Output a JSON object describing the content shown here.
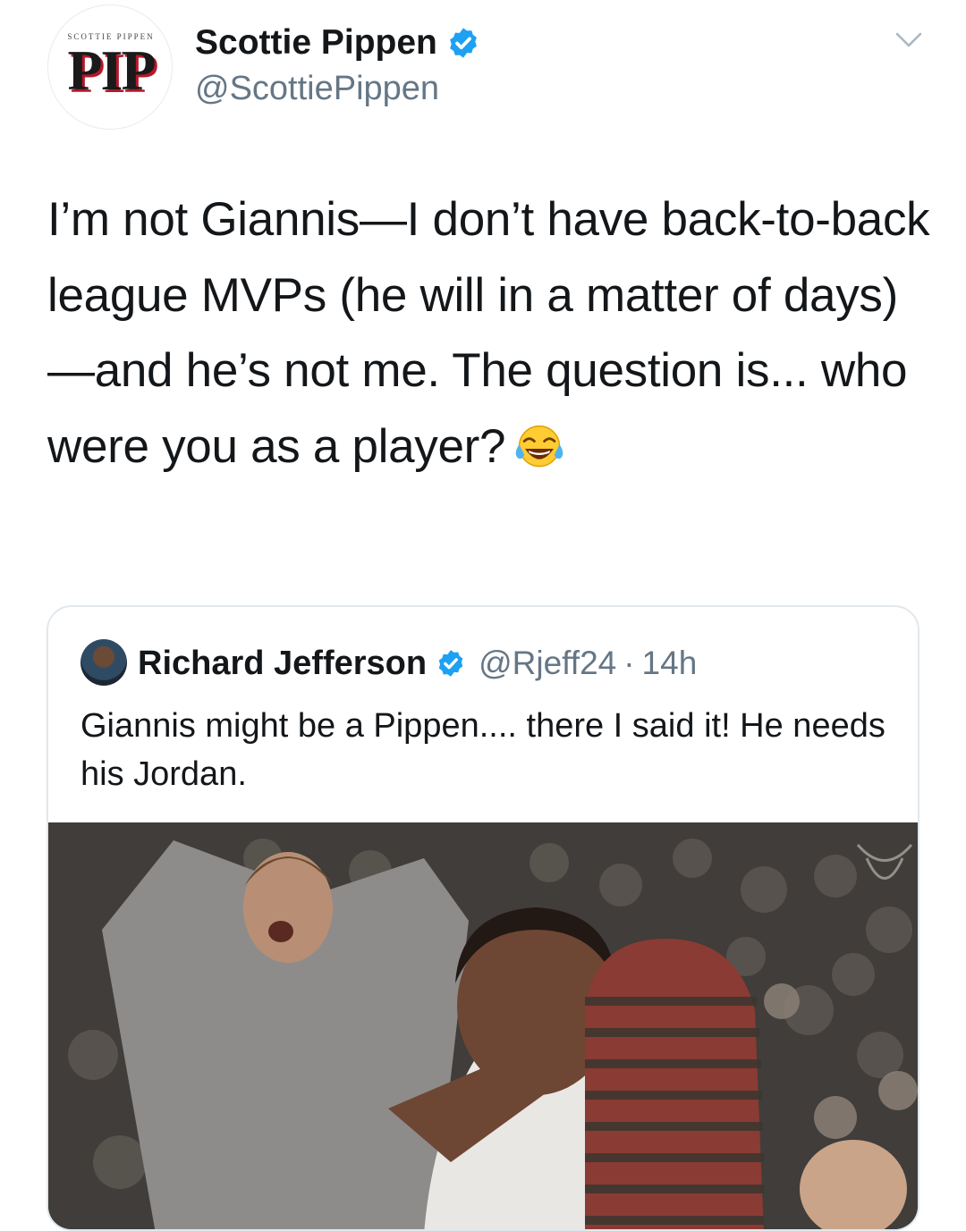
{
  "author": {
    "avatar_logo_top": "SCOTTIE PIPPEN",
    "avatar_logo_main": "PIP",
    "name": "Scottie Pippen",
    "handle": "@ScottiePippen",
    "verified": true
  },
  "tweet": {
    "text": "I’m not Giannis—I don’t have back-to-back league MVPs (he will in a matter of days)—and he’s not me. The question is... who were you as a player?",
    "emoji": "face-with-tears-of-joy"
  },
  "quoted": {
    "name": "Richard Jefferson",
    "handle": "@Rjeff24",
    "separator": "·",
    "time": "14h",
    "verified": true,
    "text": "Giannis might be a Pippen.... there I said it! He needs his Jordan."
  },
  "colors": {
    "verified_blue": "#1da1f2",
    "secondary_text": "#657786",
    "border": "#e1e8ed"
  }
}
